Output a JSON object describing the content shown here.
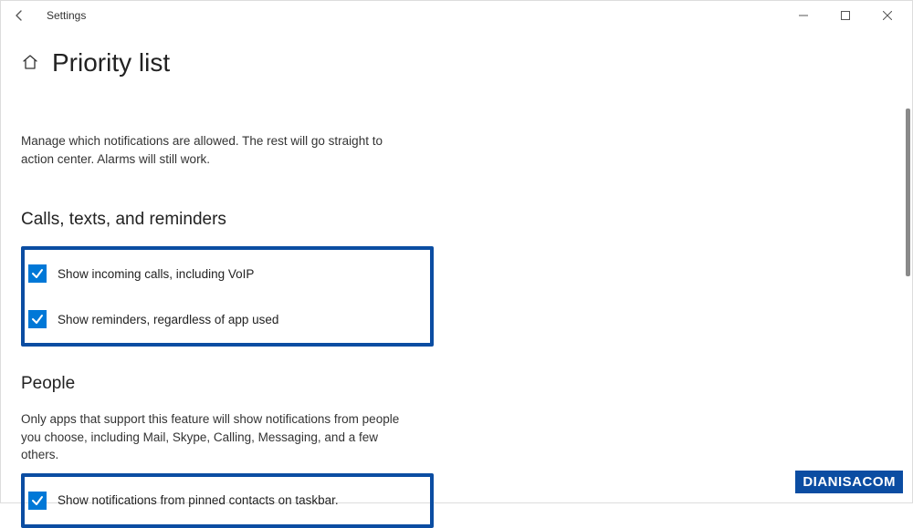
{
  "app_title": "Settings",
  "page_title": "Priority list",
  "description": "Manage which notifications are allowed. The rest will go straight to action center. Alarms will still work.",
  "section1": {
    "heading": "Calls, texts, and reminders",
    "items": [
      {
        "label": "Show incoming calls, including VoIP",
        "checked": true
      },
      {
        "label": "Show reminders, regardless of app used",
        "checked": true
      }
    ]
  },
  "section2": {
    "heading": "People",
    "description": "Only apps that support this feature will show notifications from people you choose, including Mail, Skype, Calling, Messaging, and a few others.",
    "items": [
      {
        "label": "Show notifications from pinned contacts on taskbar.",
        "checked": true
      }
    ]
  },
  "watermark": "DIANISACOM"
}
